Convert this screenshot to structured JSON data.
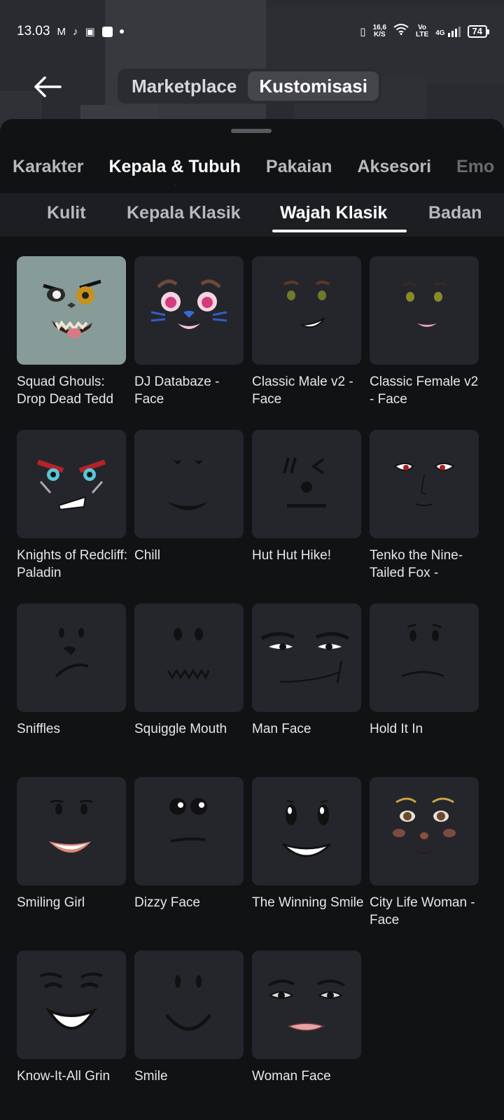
{
  "status_bar": {
    "time": "13.03",
    "net_speed_top": "16,6",
    "net_speed_unit": "K/S",
    "volte_top": "Vo",
    "volte_bottom": "LTE",
    "network": "4G",
    "battery": "74"
  },
  "header": {
    "segments": [
      {
        "label": "Marketplace",
        "active": false
      },
      {
        "label": "Kustomisasi",
        "active": true
      }
    ]
  },
  "category_tabs": [
    {
      "label": "Karakter",
      "active": false
    },
    {
      "label": "Kepala & Tubuh",
      "active": true
    },
    {
      "label": "Pakaian",
      "active": false
    },
    {
      "label": "Aksesori",
      "active": false
    },
    {
      "label": "Emo",
      "active": false
    }
  ],
  "sub_tabs": [
    {
      "label": "Kulit",
      "active": false
    },
    {
      "label": "Kepala Klasik",
      "active": false
    },
    {
      "label": "Wajah Klasik",
      "active": true
    },
    {
      "label": "Badan",
      "active": false
    }
  ],
  "items": [
    {
      "name": "Squad Ghouls: Drop Dead Tedd",
      "icon": "zombie-face-icon"
    },
    {
      "name": "DJ Databaze - Face",
      "icon": "cat-face-icon"
    },
    {
      "name": "Classic Male v2 - Face",
      "icon": "classic-male-face-icon"
    },
    {
      "name": "Classic Female v2 - Face",
      "icon": "classic-female-face-icon"
    },
    {
      "name": "Knights of Redcliff: Paladin",
      "icon": "paladin-face-icon"
    },
    {
      "name": "Chill",
      "icon": "chill-face-icon"
    },
    {
      "name": "Hut Hut Hike!",
      "icon": "hut-hut-hike-face-icon"
    },
    {
      "name": "Tenko the Nine-Tailed Fox -",
      "icon": "fox-face-icon"
    },
    {
      "name": "Sniffles",
      "icon": "sniffles-face-icon"
    },
    {
      "name": "Squiggle Mouth",
      "icon": "squiggle-mouth-face-icon"
    },
    {
      "name": "Man Face",
      "icon": "man-face-icon"
    },
    {
      "name": "Hold It In",
      "icon": "hold-it-in-face-icon"
    },
    {
      "name": "Smiling Girl",
      "icon": "smiling-girl-face-icon"
    },
    {
      "name": "Dizzy Face",
      "icon": "dizzy-face-icon"
    },
    {
      "name": "The Winning Smile",
      "icon": "winning-smile-face-icon"
    },
    {
      "name": "City Life Woman - Face",
      "icon": "city-life-woman-face-icon"
    },
    {
      "name": "Know-It-All Grin",
      "icon": "know-it-all-grin-face-icon"
    },
    {
      "name": "Smile",
      "icon": "smile-face-icon"
    },
    {
      "name": "Woman Face",
      "icon": "woman-face-icon"
    }
  ]
}
